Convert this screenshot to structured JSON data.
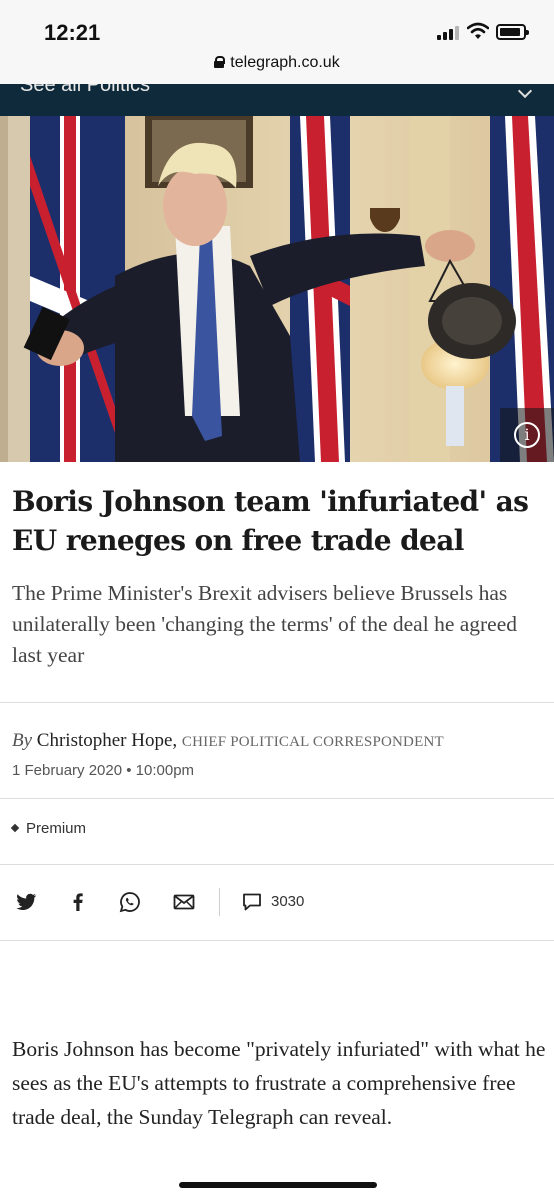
{
  "status_bar": {
    "time": "12:21",
    "url": "telegraph.co.uk"
  },
  "section_nav": {
    "label": "See all Politics"
  },
  "hero": {
    "info_icon": "info-icon",
    "info_glyph": "i"
  },
  "article": {
    "headline": "Boris Johnson team 'infuriated' as EU reneges on free trade deal",
    "standfirst": "The Prime Minister's Brexit advisers believe Brussels has unilaterally been 'changing the terms' of the deal he agreed last year",
    "byline": {
      "prefix": "By",
      "author": "Christopher Hope,",
      "role": "CHIEF POLITICAL CORRESPONDENT"
    },
    "date": "1 February 2020 • 10:00pm",
    "premium_label": "Premium",
    "share": {
      "comment_count": "3030"
    },
    "body": "Boris Johnson has become \"privately infuriated\" with what he sees as the EU's attempts to frustrate a comprehensive free trade deal, the Sunday Telegraph can reveal."
  },
  "colors": {
    "nav_background": "#0f2a3a",
    "text": "#222222",
    "divider": "#dddddd"
  }
}
